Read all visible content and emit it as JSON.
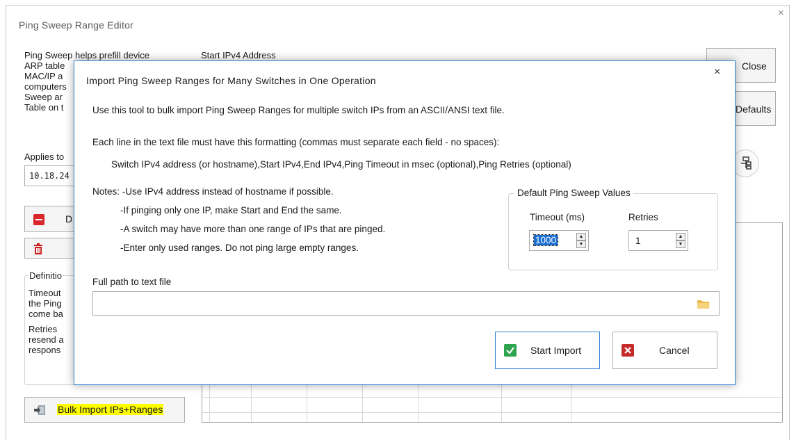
{
  "outer": {
    "title": "Ping Sweep Range Editor",
    "close_glyph": "×",
    "description": [
      "Ping Sweep helps prefill device",
      "ARP table",
      "MAC/IP a",
      "computers",
      "Sweep ar",
      "Table on t"
    ],
    "start_ipv4_label": "Start IPv4 Address",
    "applies_to_label": "Applies to",
    "applies_to_value": "10.18.24",
    "delete_button_label": "D",
    "definitions_label": "Definitio",
    "definitions_text": [
      "Timeout",
      "the Ping",
      "come ba",
      "Retries",
      "resend a",
      "respons"
    ],
    "close_button_label": "Close",
    "defaults_button_label": "Defaults",
    "bulk_import_label": "Bulk Import IPs+Ranges",
    "colors": {
      "highlight": "#ffff00",
      "accent": "#2f82d8",
      "delete_red": "#d9262a"
    }
  },
  "dialog": {
    "title": "Import Ping Sweep Ranges for Many Switches in One Operation",
    "close_glyph": "×",
    "intro": "Use this tool to bulk import Ping Sweep Ranges for multiple switch IPs from an ASCII/ANSI text file.",
    "format_heading": "Each line in the text file must have this formatting (commas must separate each field - no spaces):",
    "format_line": "Switch IPv4 address (or hostname),Start IPv4,End IPv4,Ping Timeout in msec (optional),Ping Retries (optional)",
    "notes_prefix": "Notes: -Use IPv4 address instead of hostname if possible.",
    "notes": [
      "-If pinging only one IP, make Start and End the same.",
      "-A switch may have more than one range of IPs that are pinged.",
      "-Enter only used ranges. Do not ping large empty ranges."
    ],
    "defaults_group_label": "Default Ping Sweep Values",
    "timeout_label": "Timeout (ms)",
    "timeout_value": "1000",
    "retries_label": "Retries",
    "retries_value": "1",
    "path_label": "Full path to text file",
    "path_value": "",
    "start_import_label": "Start Import",
    "cancel_label": "Cancel",
    "icons": [
      "folder-icon",
      "check-icon",
      "cancel-x-icon"
    ]
  }
}
